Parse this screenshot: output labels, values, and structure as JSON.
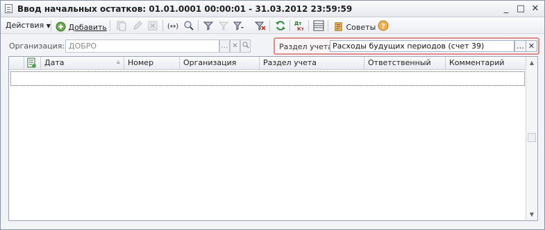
{
  "window": {
    "title": "Ввод начальных остатков: 01.01.0001 00:00:01 - 31.03.2012 23:59:59",
    "minimize": "_",
    "maximize": "□",
    "close": "✕"
  },
  "toolbar": {
    "actions_label": "Действия",
    "add_label": "Добавить",
    "tips_label": "Советы",
    "icons": [
      "copy-icon",
      "edit-icon",
      "delete-icon",
      "set-interval-icon",
      "search-icon",
      "filter-icon",
      "filter-value-icon",
      "filter-list-icon",
      "clear-filter-icon",
      "refresh-icon",
      "dt-kt-icon",
      "list-settings-icon",
      "tips-icon",
      "help-icon"
    ]
  },
  "filters": {
    "org_label": "Организация:",
    "org_value": "ДОБРО",
    "section_label": "Раздел учета:",
    "section_value": "Расходы будущих периодов (счет 39)"
  },
  "table": {
    "columns": [
      "Дата",
      "Номер",
      "Организация",
      "Раздел учета",
      "Ответственный",
      "Комментарий"
    ],
    "rows": []
  }
}
